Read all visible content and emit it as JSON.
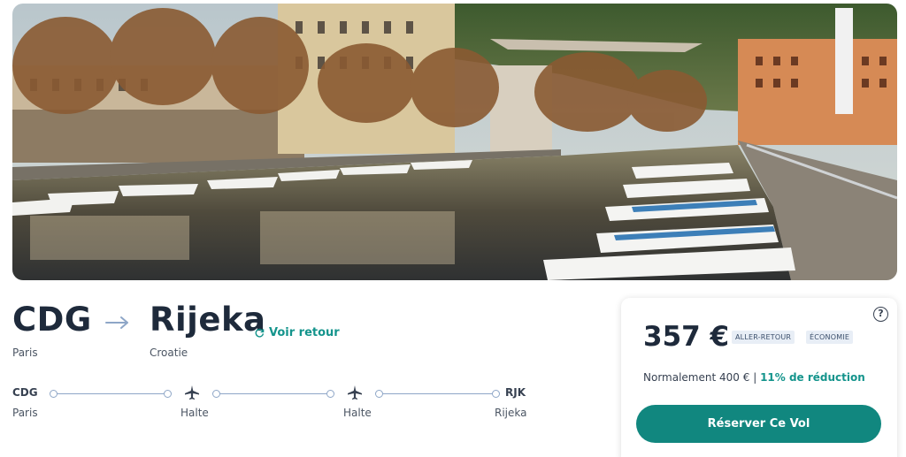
{
  "hero": {
    "image_description_icon": "harbor-photo-icon"
  },
  "route": {
    "origin_code": "CDG",
    "destination_name": "Rijeka",
    "origin_city": "Paris",
    "destination_country": "Croatie",
    "return_link": "Voir retour",
    "return_icon": "refresh-icon"
  },
  "timeline": {
    "start_code": "CDG",
    "start_city": "Paris",
    "stops": [
      "Halte",
      "Halte"
    ],
    "end_code": "RJK",
    "end_city": "Rijeka",
    "line_color": "#8ea6c7"
  },
  "card": {
    "price": "357 €",
    "trip_type": "ALLER-RETOUR",
    "cabin": "ÉCONOMIE",
    "normal_price": "Normalement 400 €",
    "separator": "|",
    "discount": "11% de réduction",
    "book_button": "Réserver Ce Vol",
    "help_icon": "?",
    "accent_color": "#11877f"
  }
}
